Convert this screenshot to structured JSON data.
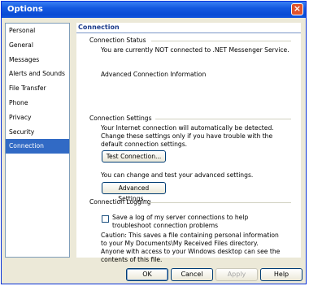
{
  "window": {
    "title": "Options",
    "close_label": "×"
  },
  "sidebar": {
    "items": [
      {
        "label": "Personal"
      },
      {
        "label": "General"
      },
      {
        "label": "Messages"
      },
      {
        "label": "Alerts and Sounds"
      },
      {
        "label": "File Transfer"
      },
      {
        "label": "Phone"
      },
      {
        "label": "Privacy"
      },
      {
        "label": "Security"
      },
      {
        "label": "Connection",
        "selected": true
      }
    ]
  },
  "panel": {
    "title": "Connection",
    "status": {
      "heading": "Connection Status",
      "text": "You are currently NOT connected to .NET Messenger Service.",
      "advanced_info": "Advanced Connection Information"
    },
    "settings": {
      "heading": "Connection Settings",
      "text": "Your Internet connection will automatically be detected.  Change these settings only if you have trouble with the default connection settings.",
      "test_button": "Test Connection...",
      "advanced_text": "You can change and test your advanced settings.",
      "advanced_button": "Advanced Settings..."
    },
    "logging": {
      "heading": "Connection Logging",
      "checkbox_label": "Save a log of my server connections to help troubleshoot connection problems",
      "checked": false,
      "caution": "Caution:  This saves a file containing personal information to your My Documents\\My Received Files directory.  Anyone with access to your Windows desktop can see the contents of this file."
    }
  },
  "footer": {
    "ok": "OK",
    "cancel": "Cancel",
    "apply": "Apply",
    "help": "Help"
  }
}
